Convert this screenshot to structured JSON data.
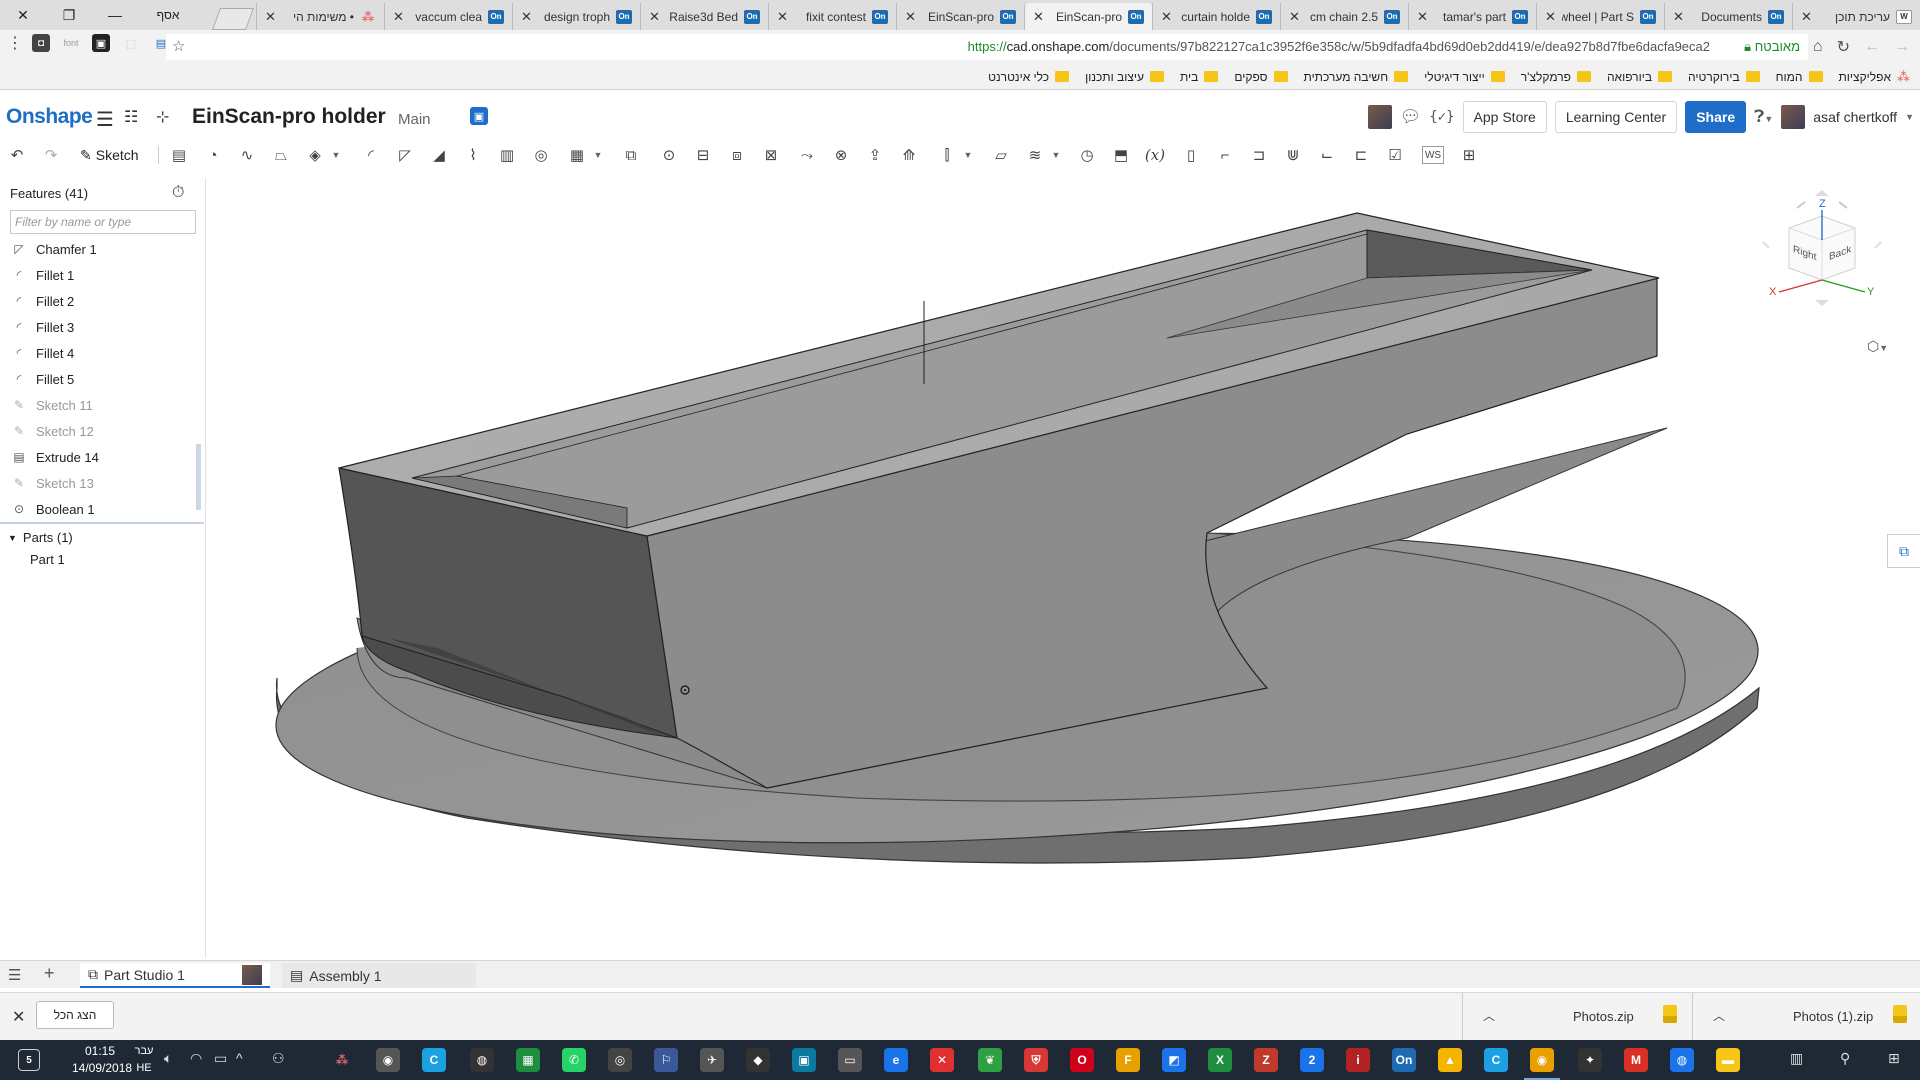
{
  "browser": {
    "tabs": [
      {
        "title": "עריכת תוכן",
        "icon": "wix"
      },
      {
        "title": "Documents",
        "icon": "onshape"
      },
      {
        "title": "wheel | Part S",
        "icon": "onshape"
      },
      {
        "title": "tamar's part",
        "icon": "onshape"
      },
      {
        "title": "2.5 cm chain",
        "icon": "onshape"
      },
      {
        "title": "curtain holde",
        "icon": "onshape"
      },
      {
        "title": "EinScan-pro",
        "icon": "onshape",
        "active": true
      },
      {
        "title": "EinScan-pro",
        "icon": "onshape"
      },
      {
        "title": "fixit contest",
        "icon": "onshape"
      },
      {
        "title": "Raise3d Bed",
        "icon": "onshape"
      },
      {
        "title": "design troph",
        "icon": "onshape"
      },
      {
        "title": "vaccum clea",
        "icon": "onshape"
      },
      {
        "title": "• משימות הי",
        "icon": "asana"
      }
    ],
    "profile_label": "אסף",
    "url_prefix": "https://",
    "url_host": "cad.onshape.com",
    "url_path": "/documents/97b822127ca1c3952f6e358c/w/5b9dfadfa4bd69d0eb2dd419/e/dea927b8d7fbe6dacfa9eca2",
    "secure_label": "מאובטח",
    "bookmarks": [
      {
        "label": "אפליקציות",
        "type": "apps"
      },
      {
        "label": "המוח",
        "type": "folder"
      },
      {
        "label": "בירוקרטיה",
        "type": "folder"
      },
      {
        "label": "ביורפואה",
        "type": "folder"
      },
      {
        "label": "פרמקלצ'ר",
        "type": "folder"
      },
      {
        "label": "ייצור דיגיטלי",
        "type": "folder"
      },
      {
        "label": "חשיבה מערכתית",
        "type": "folder"
      },
      {
        "label": "ספקים",
        "type": "folder"
      },
      {
        "label": "בית",
        "type": "folder"
      },
      {
        "label": "עיצוב ותכנון",
        "type": "folder"
      },
      {
        "label": "כלי אינטרנט",
        "type": "folder"
      }
    ]
  },
  "onshape": {
    "logo": "Onshape",
    "document_title": "EinScan-pro holder",
    "workspace": "Main",
    "app_store": "App Store",
    "learning_center": "Learning Center",
    "share": "Share",
    "user_name": "asaf chertkoff",
    "sketch_label": "Sketch",
    "ws_label": "WS"
  },
  "feature_panel": {
    "title": "Features (41)",
    "filter_placeholder": "Filter by name or type",
    "items": [
      {
        "label": "Chamfer 1",
        "icon": "chamfer-icon",
        "suppressed": false
      },
      {
        "label": "Fillet 1",
        "icon": "fillet-icon",
        "suppressed": false
      },
      {
        "label": "Fillet 2",
        "icon": "fillet-icon",
        "suppressed": false
      },
      {
        "label": "Fillet 3",
        "icon": "fillet-icon",
        "suppressed": false
      },
      {
        "label": "Fillet 4",
        "icon": "fillet-icon",
        "suppressed": false
      },
      {
        "label": "Fillet 5",
        "icon": "fillet-icon",
        "suppressed": false
      },
      {
        "label": "Sketch 11",
        "icon": "sketch-icon",
        "suppressed": true
      },
      {
        "label": "Sketch 12",
        "icon": "sketch-icon",
        "suppressed": true
      },
      {
        "label": "Extrude 14",
        "icon": "extrude-icon",
        "suppressed": false
      },
      {
        "label": "Sketch 13",
        "icon": "sketch-icon",
        "suppressed": true
      },
      {
        "label": "Boolean 1",
        "icon": "boolean-icon",
        "suppressed": false
      }
    ],
    "parts_label": "Parts (1)",
    "part_item": "Part 1"
  },
  "viewcube": {
    "z": "Z",
    "x": "X",
    "y": "Y",
    "right": "Right",
    "back": "Back"
  },
  "bottom_tabs": {
    "part_studio": "Part Studio 1",
    "assembly": "Assembly 1"
  },
  "downloads": {
    "show_all": "הצג הכל",
    "items": [
      "Photos (1).zip",
      "Photos.zip"
    ]
  },
  "taskbar": {
    "time": "01:15",
    "date": "14/09/2018",
    "lang_top": "עבר",
    "lang_bottom": "HE",
    "notification_count": "5"
  },
  "colors": {
    "onshape_blue": "#1e6ec9",
    "secure_green": "#1a8a2a",
    "model_gray": "#8e8e8e"
  }
}
